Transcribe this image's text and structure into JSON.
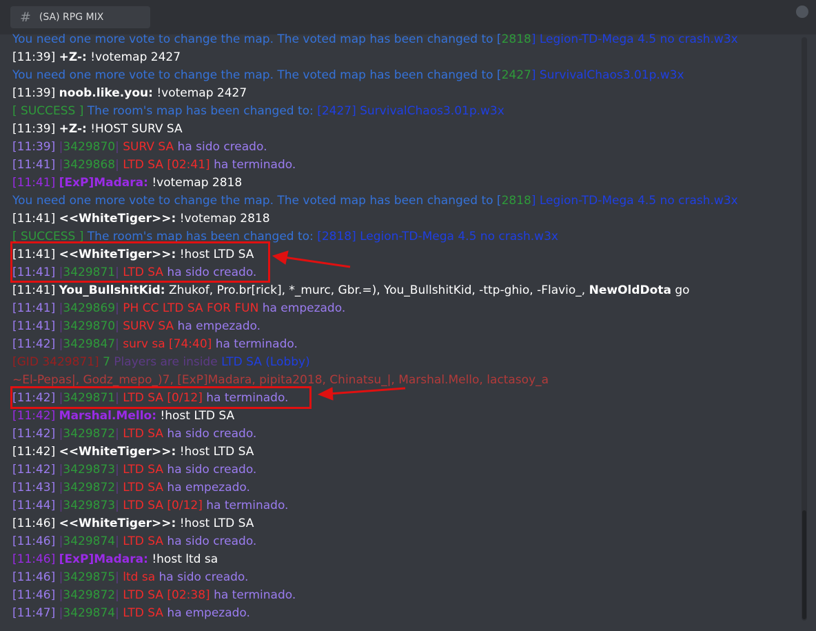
{
  "channel": {
    "icon": "hash-icon",
    "name": "(SA) RPG MIX"
  },
  "colors": {
    "background": "#36393f",
    "highlight": "#e01010"
  },
  "messages": [
    [
      {
        "t": "You need one more vote to change the map. The voted map has been changed to ",
        "c": "lb"
      },
      {
        "t": "[",
        "c": "lb"
      },
      {
        "t": "2818",
        "c": "g"
      },
      {
        "t": "] Legion-TD-Mega 4.5 no crash.w3x",
        "c": "db"
      }
    ],
    [
      {
        "t": "[11:39] ",
        "c": "w"
      },
      {
        "t": "+Z-:",
        "c": "b"
      },
      {
        "t": " !votemap 2427",
        "c": "w"
      }
    ],
    [
      {
        "t": "You need one more vote to change the map. The voted map has been changed to ",
        "c": "lb"
      },
      {
        "t": "[",
        "c": "lb"
      },
      {
        "t": "2427",
        "c": "g"
      },
      {
        "t": "] SurvivalChaos3.01p.w3x",
        "c": "db"
      }
    ],
    [
      {
        "t": "[11:39] ",
        "c": "w"
      },
      {
        "t": "noob.like.you:",
        "c": "b"
      },
      {
        "t": " !votemap 2427",
        "c": "w"
      }
    ],
    [
      {
        "t": "[ SUCCESS ] ",
        "c": "g"
      },
      {
        "t": "The room's map has been changed to: ",
        "c": "lb"
      },
      {
        "t": "[2427] SurvivalChaos3.01p.w3x",
        "c": "db"
      }
    ],
    [
      {
        "t": "[11:39] ",
        "c": "w"
      },
      {
        "t": "+Z-:",
        "c": "b"
      },
      {
        "t": " !HOST SURV SA",
        "c": "w"
      }
    ],
    [
      {
        "t": "[11:39] ",
        "c": "pu"
      },
      {
        "t": "|",
        "c": "dk"
      },
      {
        "t": "3429870",
        "c": "g"
      },
      {
        "t": "| ",
        "c": "dk"
      },
      {
        "t": "SURV SA",
        "c": "r"
      },
      {
        "t": " ha sido creado.",
        "c": "pu"
      }
    ],
    [
      {
        "t": "[11:41] ",
        "c": "pu"
      },
      {
        "t": "|",
        "c": "dk"
      },
      {
        "t": "3429868",
        "c": "g"
      },
      {
        "t": "| ",
        "c": "dk"
      },
      {
        "t": "LTD SA [02:41]",
        "c": "r"
      },
      {
        "t": " ha terminado.",
        "c": "pu"
      }
    ],
    [
      {
        "t": "[11:41] ",
        "c": "vp"
      },
      {
        "t": "[ExP]Madara:",
        "c": "vp b2"
      },
      {
        "t": " !votemap 2818",
        "c": "w"
      }
    ],
    [
      {
        "t": "You need one more vote to change the map. The voted map has been changed to ",
        "c": "lb"
      },
      {
        "t": "[",
        "c": "lb"
      },
      {
        "t": "2818",
        "c": "g"
      },
      {
        "t": "] Legion-TD-Mega 4.5 no crash.w3x",
        "c": "db"
      }
    ],
    [
      {
        "t": "[11:41] ",
        "c": "w"
      },
      {
        "t": "<<WhiteTiger>>:",
        "c": "b"
      },
      {
        "t": " !votemap 2818",
        "c": "w"
      }
    ],
    [
      {
        "t": "[ SUCCESS ] ",
        "c": "g"
      },
      {
        "t": "The room's map has been changed to: ",
        "c": "lb"
      },
      {
        "t": "[2818] Legion-TD-Mega 4.5 no crash.w3x",
        "c": "db"
      }
    ],
    [
      {
        "t": "[11:41] ",
        "c": "w"
      },
      {
        "t": "<<WhiteTiger>>:",
        "c": "b"
      },
      {
        "t": " !host LTD SA",
        "c": "w"
      }
    ],
    [
      {
        "t": "[11:41] ",
        "c": "pu"
      },
      {
        "t": "|",
        "c": "dk"
      },
      {
        "t": "3429871",
        "c": "g"
      },
      {
        "t": "| ",
        "c": "dk"
      },
      {
        "t": "LTD SA",
        "c": "r"
      },
      {
        "t": " ha sido creado.",
        "c": "pu"
      }
    ],
    [
      {
        "t": "[11:41] ",
        "c": "w"
      },
      {
        "t": "You_BullshitKid:",
        "c": "b"
      },
      {
        "t": " Zhukof, Pro.br[rick], *_murc, Gbr.=), You_BullshitKid, -ttp-ghio, -Flavio_, ",
        "c": "w"
      },
      {
        "t": "NewOldDota",
        "c": "b"
      },
      {
        "t": " go",
        "c": "w"
      }
    ],
    [
      {
        "t": "[11:41] ",
        "c": "pu"
      },
      {
        "t": "|",
        "c": "dk"
      },
      {
        "t": "3429869",
        "c": "g"
      },
      {
        "t": "| ",
        "c": "dk"
      },
      {
        "t": "PH CC LTD SA FOR FUN",
        "c": "r"
      },
      {
        "t": " ha empezado.",
        "c": "pu"
      }
    ],
    [
      {
        "t": "[11:41] ",
        "c": "pu"
      },
      {
        "t": "|",
        "c": "dk"
      },
      {
        "t": "3429870",
        "c": "g"
      },
      {
        "t": "| ",
        "c": "dk"
      },
      {
        "t": "SURV SA",
        "c": "r"
      },
      {
        "t": " ha empezado.",
        "c": "pu"
      }
    ],
    [
      {
        "t": "[11:42] ",
        "c": "pu"
      },
      {
        "t": "|",
        "c": "dk"
      },
      {
        "t": "3429847",
        "c": "g"
      },
      {
        "t": "| ",
        "c": "dk"
      },
      {
        "t": "surv sa [74:40]",
        "c": "r"
      },
      {
        "t": " ha terminado.",
        "c": "pu"
      }
    ],
    [
      {
        "t": "[GID 3429871] ",
        "c": "br"
      },
      {
        "t": "7 ",
        "c": "g"
      },
      {
        "t": "Players are inside ",
        "c": "dk"
      },
      {
        "t": "LTD SA (Lobby)",
        "c": "db"
      }
    ],
    [
      {
        "t": "~El-Pepas|, Godz_mepo_)7, [ExP]Madara, pipita2018, Chinatsu_|, Marshal.Mello, lactasoy_a",
        "c": "mr"
      }
    ],
    [
      {
        "t": "[11:42] ",
        "c": "pu"
      },
      {
        "t": "|",
        "c": "dk"
      },
      {
        "t": "3429871",
        "c": "g"
      },
      {
        "t": "| ",
        "c": "dk"
      },
      {
        "t": "LTD SA [0/12]",
        "c": "r"
      },
      {
        "t": " ha terminado.",
        "c": "pu"
      }
    ],
    [
      {
        "t": "[11:42] ",
        "c": "vp"
      },
      {
        "t": "Marshal.Mello:",
        "c": "vp b2"
      },
      {
        "t": " !host LTD SA",
        "c": "w"
      }
    ],
    [
      {
        "t": "[11:42] ",
        "c": "pu"
      },
      {
        "t": "|",
        "c": "dk"
      },
      {
        "t": "3429872",
        "c": "g"
      },
      {
        "t": "| ",
        "c": "dk"
      },
      {
        "t": "LTD SA",
        "c": "r"
      },
      {
        "t": " ha sido creado.",
        "c": "pu"
      }
    ],
    [
      {
        "t": "[11:42] ",
        "c": "w"
      },
      {
        "t": "<<WhiteTiger>>:",
        "c": "b"
      },
      {
        "t": " !host LTD SA",
        "c": "w"
      }
    ],
    [
      {
        "t": "[11:42] ",
        "c": "pu"
      },
      {
        "t": "|",
        "c": "dk"
      },
      {
        "t": "3429873",
        "c": "g"
      },
      {
        "t": "| ",
        "c": "dk"
      },
      {
        "t": "LTD SA",
        "c": "r"
      },
      {
        "t": " ha sido creado.",
        "c": "pu"
      }
    ],
    [
      {
        "t": "[11:43] ",
        "c": "pu"
      },
      {
        "t": "|",
        "c": "dk"
      },
      {
        "t": "3429872",
        "c": "g"
      },
      {
        "t": "| ",
        "c": "dk"
      },
      {
        "t": "LTD SA",
        "c": "r"
      },
      {
        "t": " ha empezado.",
        "c": "pu"
      }
    ],
    [
      {
        "t": "[11:44] ",
        "c": "pu"
      },
      {
        "t": "|",
        "c": "dk"
      },
      {
        "t": "3429873",
        "c": "g"
      },
      {
        "t": "| ",
        "c": "dk"
      },
      {
        "t": "LTD SA [0/12]",
        "c": "r"
      },
      {
        "t": " ha terminado.",
        "c": "pu"
      }
    ],
    [
      {
        "t": "[11:46] ",
        "c": "w"
      },
      {
        "t": "<<WhiteTiger>>:",
        "c": "b"
      },
      {
        "t": " !host LTD SA",
        "c": "w"
      }
    ],
    [
      {
        "t": "[11:46] ",
        "c": "pu"
      },
      {
        "t": "|",
        "c": "dk"
      },
      {
        "t": "3429874",
        "c": "g"
      },
      {
        "t": "| ",
        "c": "dk"
      },
      {
        "t": "LTD SA",
        "c": "r"
      },
      {
        "t": " ha sido creado.",
        "c": "pu"
      }
    ],
    [
      {
        "t": "[11:46] ",
        "c": "vp"
      },
      {
        "t": "[ExP]Madara:",
        "c": "vp b2"
      },
      {
        "t": " !host ltd sa",
        "c": "w"
      }
    ],
    [
      {
        "t": "[11:46] ",
        "c": "pu"
      },
      {
        "t": "|",
        "c": "dk"
      },
      {
        "t": "3429875",
        "c": "g"
      },
      {
        "t": "| ",
        "c": "dk"
      },
      {
        "t": "ltd sa",
        "c": "r"
      },
      {
        "t": " ha sido creado.",
        "c": "pu"
      }
    ],
    [
      {
        "t": "[11:46] ",
        "c": "pu"
      },
      {
        "t": "|",
        "c": "dk"
      },
      {
        "t": "3429872",
        "c": "g"
      },
      {
        "t": "| ",
        "c": "dk"
      },
      {
        "t": "LTD SA [02:38]",
        "c": "r"
      },
      {
        "t": " ha terminado.",
        "c": "pu"
      }
    ],
    [
      {
        "t": "[11:47] ",
        "c": "pu"
      },
      {
        "t": "|",
        "c": "dk"
      },
      {
        "t": "3429874",
        "c": "g"
      },
      {
        "t": "| ",
        "c": "dk"
      },
      {
        "t": "LTD SA",
        "c": "r"
      },
      {
        "t": " ha empezado.",
        "c": "pu"
      }
    ]
  ]
}
